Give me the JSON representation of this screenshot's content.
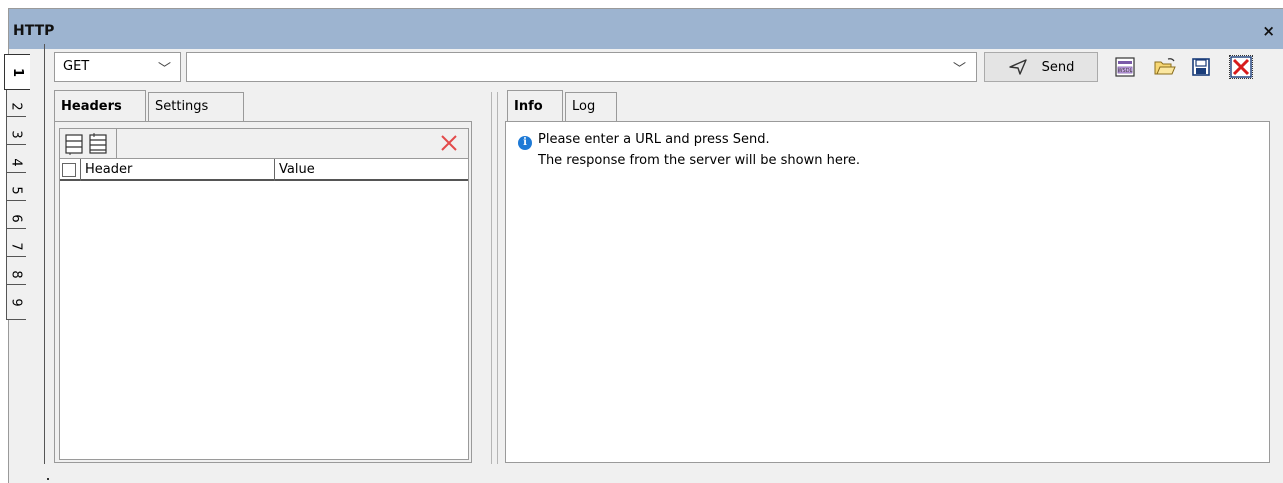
{
  "window": {
    "title": "HTTP",
    "close_glyph": "×"
  },
  "vertical_tabs": [
    "1",
    "2",
    "3",
    "4",
    "5",
    "6",
    "7",
    "8",
    "9"
  ],
  "active_vertical_tab": "1",
  "toolbar": {
    "method": "GET",
    "url_value": "",
    "send_label": "Send",
    "icons": [
      "wsdl-icon",
      "open-folder-icon",
      "save-icon",
      "close-icon"
    ]
  },
  "left_panel": {
    "tabs": [
      {
        "label": "Headers",
        "active": true
      },
      {
        "label": "Settings",
        "active": false
      }
    ],
    "columns": [
      "Header",
      "Value"
    ]
  },
  "right_panel": {
    "tabs": [
      {
        "label": "Info",
        "active": true
      },
      {
        "label": "Log",
        "active": false
      }
    ],
    "info_line1": "Please enter a URL and press Send.",
    "info_line2": "The response from the server will be shown here."
  },
  "colors": {
    "titlebar": "#9db4d0",
    "info_icon": "#1e7ad6",
    "delete_icon": "#e34b4b"
  }
}
